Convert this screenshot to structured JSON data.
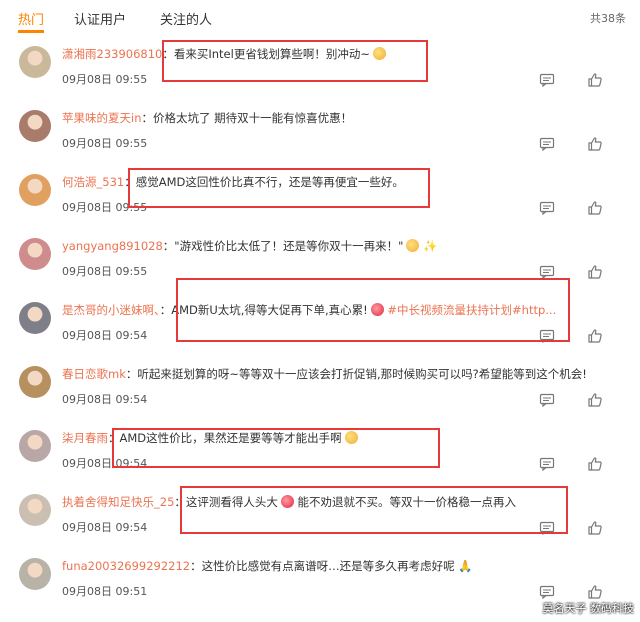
{
  "tabs": [
    {
      "label": "热门",
      "active": true
    },
    {
      "label": "认证用户",
      "active": false
    },
    {
      "label": "关注的人",
      "active": false
    }
  ],
  "total": "共38条",
  "colors": {
    "accent": "#ff8200",
    "username": "#eb7350",
    "highlight_box": "#e63a3a"
  },
  "comments": [
    {
      "user": "潇湘雨233906810",
      "text": "看来买Intel更省钱划算些啊！别冲动~",
      "emoji": "grin",
      "time": "09月08日 09:55"
    },
    {
      "user": "苹果味的夏天in",
      "text": "价格太坑了 期待双十一能有惊喜优惠！",
      "time": "09月08日 09:55"
    },
    {
      "user": "何浩源_531",
      "text": "感觉AMD这回性价比真不行，还是等再便宜一些好。",
      "time": "09月08日 09:55"
    },
    {
      "user": "yangyang891028",
      "text": "\"游戏性价比太低了！还是等你双十一再来！\"",
      "emoji": "grin",
      "extra": "✨",
      "time": "09月08日 09:55"
    },
    {
      "user": "是杰哥的小迷妹啊、",
      "text": "AMD新U太坑,得等大促再下单,真心累!",
      "emoji": "angry",
      "topic": "#中长视频流量扶持计划#http...",
      "time": "09月08日 09:54"
    },
    {
      "user": "春日恋歌mk",
      "text": "听起来挺划算的呀~等等双十一应该会打折促销,那时候购买可以吗?希望能等到这个机会!",
      "time": "09月08日 09:54"
    },
    {
      "user": "柒月春雨",
      "text": "AMD这性价比，果然还是要等等才能出手啊",
      "emoji": "grin",
      "time": "09月08日 09:54"
    },
    {
      "user": "执着舍得知足快乐_25",
      "text": "这评测看得人头大",
      "emoji": "angry",
      "text2": "能不劝退就不买。等双十一价格稳一点再入",
      "time": "09月08日 09:54"
    },
    {
      "user": "funa20032699292212",
      "text": "这性价比感觉有点离谱呀…还是等多久再考虑好呢",
      "extra": "🙏",
      "time": "09月08日 09:51"
    }
  ],
  "watermark": "莫名天子 数码科技"
}
